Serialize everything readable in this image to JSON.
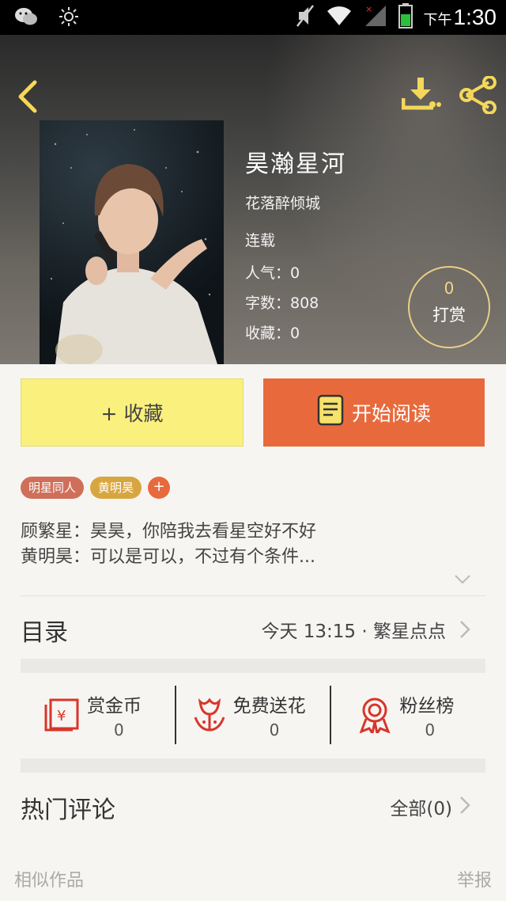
{
  "status_bar": {
    "ampm": "下午",
    "time": "1:30",
    "left_icons": [
      "wechat-icon",
      "brightness-icon"
    ],
    "right_icons": [
      "mute-icon",
      "wifi-icon",
      "signal-icon",
      "battery-icon"
    ]
  },
  "header": {
    "back_icon": "chevron-left-icon",
    "download_icon": "download-icon",
    "share_icon": "share-icon",
    "accent_color": "#f5d75a"
  },
  "book": {
    "title": "昊瀚星河",
    "author": "花落醉倾城",
    "status": "连载",
    "popularity": "人气：0",
    "word_count": "字数：808",
    "favorites": "收藏：0"
  },
  "tip": {
    "count": "0",
    "label": "打赏"
  },
  "actions": {
    "favorite_label": "+ 收藏",
    "read_label": "开始阅读",
    "favorite_color": "#f9f07d",
    "read_color": "#e86a3c"
  },
  "tags": [
    "明星同人",
    "黄明昊"
  ],
  "tag_add": "+",
  "synopsis": [
    "顾繁星：昊昊，你陪我去看星空好不好",
    "黄明昊：可以是可以，不过有个条件..."
  ],
  "catalog": {
    "title": "目录",
    "update": "今天 13:15 · 繁星点点"
  },
  "stats": [
    {
      "icon": "red-envelope-icon",
      "label": "赏金币",
      "value": "0"
    },
    {
      "icon": "flower-icon",
      "label": "免费送花",
      "value": "0"
    },
    {
      "icon": "medal-icon",
      "label": "粉丝榜",
      "value": "0"
    }
  ],
  "comments": {
    "title": "热门评论",
    "all": "全部(0)"
  },
  "footer": {
    "similar": "相似作品",
    "report": "举报"
  }
}
